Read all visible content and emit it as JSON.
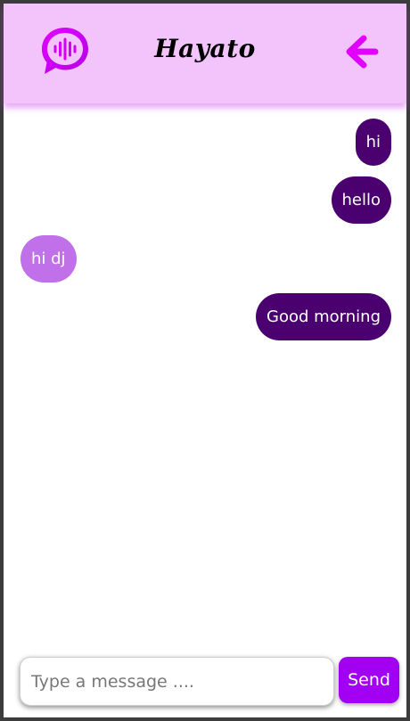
{
  "header": {
    "title": "Hayato",
    "logo_icon": "chat-audio-wave-icon",
    "back_icon": "arrow-left-icon",
    "accent_color": "#e100ff"
  },
  "messages": [
    {
      "text": "hi",
      "direction": "sent"
    },
    {
      "text": "hello",
      "direction": "sent"
    },
    {
      "text": "hi dj",
      "direction": "received"
    },
    {
      "text": "Good morning",
      "direction": "sent"
    }
  ],
  "colors": {
    "header_bg": "#f3c4fb",
    "sent_bubble": "#4a006f",
    "received_bubble": "#c070e8",
    "send_button": "#a100f2"
  },
  "composer": {
    "placeholder": "Type a message ....",
    "value": "",
    "send_label": "Send"
  }
}
